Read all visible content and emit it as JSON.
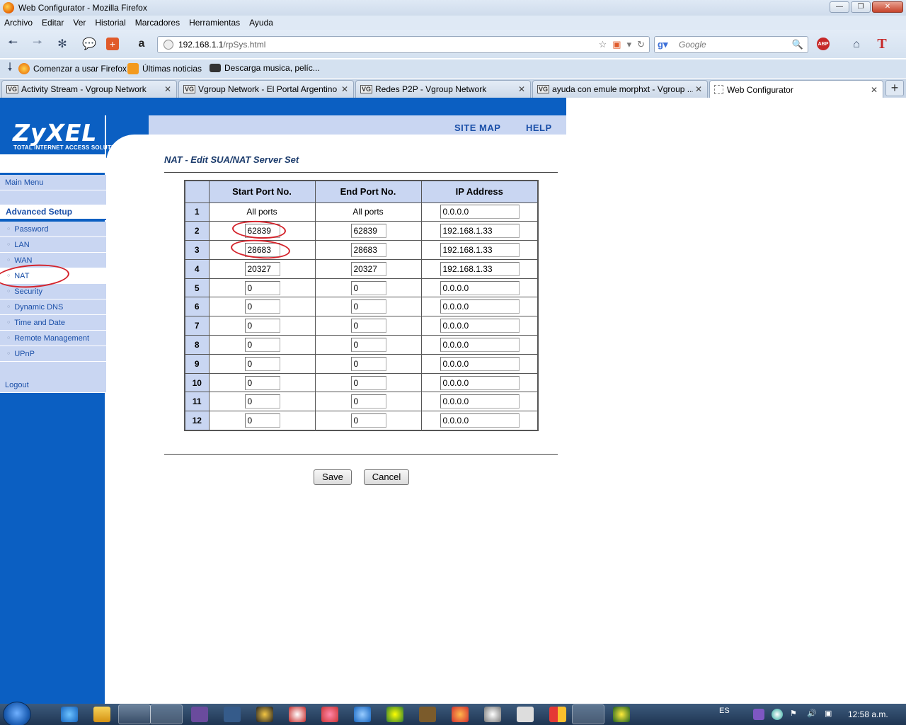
{
  "browser": {
    "window_title": "Web Configurator - Mozilla Firefox",
    "menu": [
      "Archivo",
      "Editar",
      "Ver",
      "Historial",
      "Marcadores",
      "Herramientas",
      "Ayuda"
    ],
    "url_host": "192.168.1.1",
    "url_path": "/rpSys.html",
    "search_placeholder": "Google",
    "bookmarks": [
      "Comenzar a usar Firefox",
      "Últimas noticias",
      "Descarga musica, pelíc..."
    ],
    "tabs": [
      {
        "label": "Activity Stream - Vgroup Network",
        "favicon": "VG"
      },
      {
        "label": "Vgroup Network - El Portal Argentino",
        "favicon": "VG"
      },
      {
        "label": "Redes P2P - Vgroup Network",
        "favicon": "VG"
      },
      {
        "label": "ayuda con emule morphxt - Vgroup ...",
        "favicon": "VG"
      },
      {
        "label": "Web Configurator",
        "favicon": ""
      }
    ],
    "tab_close": "✕",
    "new_tab": "+"
  },
  "brand": {
    "logo": "ZyXEL",
    "tagline": "TOTAL INTERNET ACCESS SOLUTION",
    "color_primary": "#0b5fc2",
    "color_light": "#c9d6f2"
  },
  "topnav": {
    "site_map": "SITE MAP",
    "help": "HELP"
  },
  "sidebar": {
    "main_menu": "Main Menu",
    "section": "Advanced Setup",
    "items": [
      "Password",
      "LAN",
      "WAN",
      "NAT",
      "Security",
      "Dynamic DNS",
      "Time and Date",
      "Remote Management",
      "UPnP"
    ],
    "active_item": "NAT",
    "logout": "Logout"
  },
  "main": {
    "title": "NAT - Edit SUA/NAT Server Set",
    "columns": [
      "Start Port No.",
      "End Port No.",
      "IP Address"
    ],
    "rows": [
      {
        "no": "1",
        "start": "All ports",
        "end": "All ports",
        "ip": "0.0.0.0"
      },
      {
        "no": "2",
        "start": "62839",
        "end": "62839",
        "ip": "192.168.1.33"
      },
      {
        "no": "3",
        "start": "28683",
        "end": "28683",
        "ip": "192.168.1.33"
      },
      {
        "no": "4",
        "start": "20327",
        "end": "20327",
        "ip": "192.168.1.33"
      },
      {
        "no": "5",
        "start": "0",
        "end": "0",
        "ip": "0.0.0.0"
      },
      {
        "no": "6",
        "start": "0",
        "end": "0",
        "ip": "0.0.0.0"
      },
      {
        "no": "7",
        "start": "0",
        "end": "0",
        "ip": "0.0.0.0"
      },
      {
        "no": "8",
        "start": "0",
        "end": "0",
        "ip": "0.0.0.0"
      },
      {
        "no": "9",
        "start": "0",
        "end": "0",
        "ip": "0.0.0.0"
      },
      {
        "no": "10",
        "start": "0",
        "end": "0",
        "ip": "0.0.0.0"
      },
      {
        "no": "11",
        "start": "0",
        "end": "0",
        "ip": "0.0.0.0"
      },
      {
        "no": "12",
        "start": "0",
        "end": "0",
        "ip": "0.0.0.0"
      }
    ],
    "save_label": "Save",
    "cancel_label": "Cancel"
  },
  "taskbar": {
    "language": "ES",
    "clock": "12:58 a.m."
  }
}
